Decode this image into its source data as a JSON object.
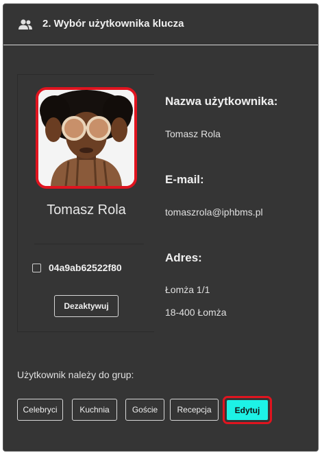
{
  "header": {
    "icon": "users-icon",
    "title": "2. Wybór użytkownika klucza"
  },
  "card": {
    "name": "Tomasz Rola",
    "key_id": "04a9ab62522f80",
    "key_checked": false,
    "deactivate_label": "Dezaktywuj"
  },
  "info": {
    "name_label": "Nazwa użytkownika:",
    "name_value": "Tomasz Rola",
    "email_label": "E-mail:",
    "email_value": "tomaszrola@iphbms.pl",
    "address_label": "Adres:",
    "address_line1": "Łomża 1/1",
    "address_line2": "18-400 Łomża"
  },
  "groups": {
    "label": "Użytkownik należy do grup:",
    "items": [
      "Celebryci",
      "Kuchnia",
      "Goście",
      "Recepcja"
    ],
    "edit_label": "Edytuj"
  },
  "colors": {
    "highlight": "#e0141f",
    "accent": "#1df2e6",
    "panel_bg": "#353535"
  }
}
